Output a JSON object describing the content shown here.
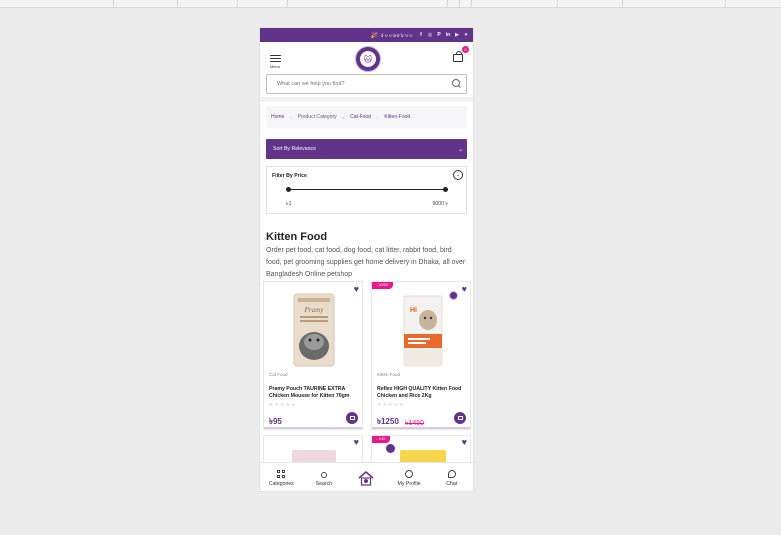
{
  "promo": {
    "phone": "🎉 ৫০০৬৮৮০০",
    "social_icons": [
      "facebook-icon",
      "instagram-icon",
      "pinterest-icon",
      "linkedin-icon",
      "youtube-icon",
      "twitter-icon"
    ]
  },
  "header": {
    "menu_label": "Menu",
    "cart_count": "0"
  },
  "search": {
    "placeholder": "What can we help you find?"
  },
  "breadcrumb": {
    "items": [
      "Home",
      "Product Category",
      "Cat-Food",
      "Kitten-Food"
    ]
  },
  "sort": {
    "selected": "Sort By Relevance"
  },
  "filter": {
    "title": "Filter By Price",
    "min_label": "৳1",
    "max_label": "9000 ৳"
  },
  "category": {
    "title": "Kitten Food",
    "description": "Order pet food, cat food, dog food, cat litter, rabbit food, bird food, pet grooming supplies get home delivery in Dhaka, all over Bangladesh Online petshop"
  },
  "products": [
    {
      "category": "Cat Food",
      "title": "Pramy Pouch TAURINE EXTRA Chicken Mousse for Kitten 70gm",
      "price": "৳95",
      "old_price": "",
      "discount": ""
    },
    {
      "category": "Kitten Food",
      "title": "Reflex HIGH QUALITY Kitten Food Chicken and Rice 2Kg",
      "price": "৳1250",
      "old_price": "৳1450",
      "discount": "- ৳200"
    }
  ],
  "more_products": [
    {
      "discount": ""
    },
    {
      "discount": "- ৳45"
    }
  ],
  "bottom_nav": {
    "categories": "Categories",
    "search": "Search",
    "profile": "My Profile",
    "chat": "Chat"
  },
  "colors": {
    "brand": "#61338a",
    "accent": "#e8198b"
  }
}
